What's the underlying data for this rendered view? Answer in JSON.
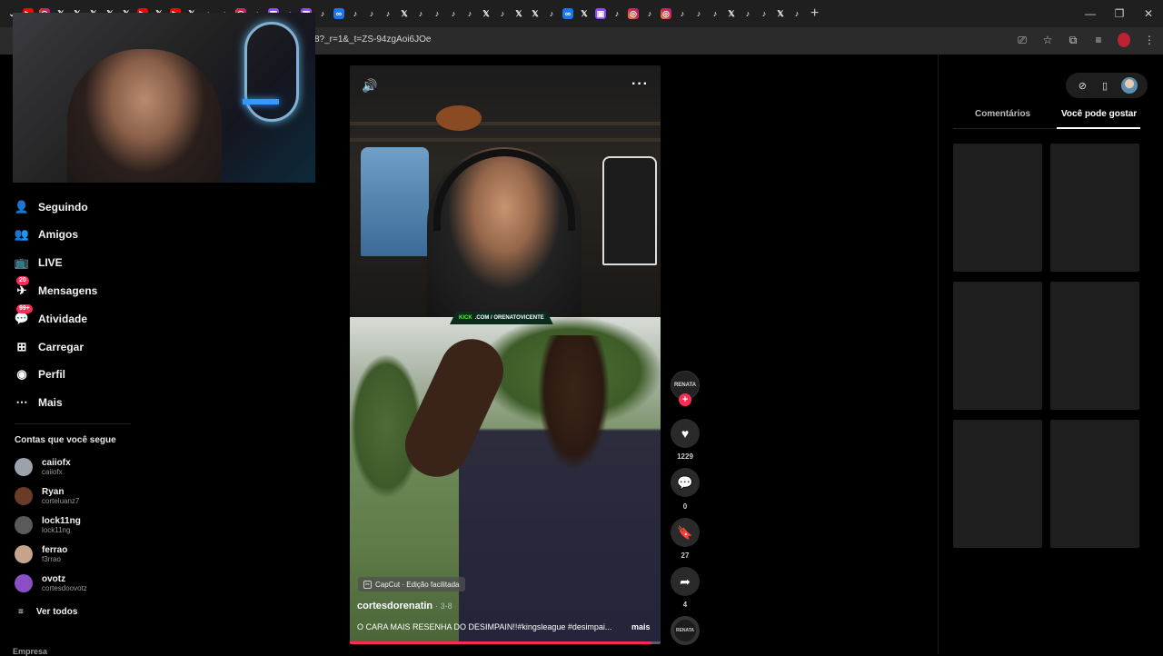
{
  "browser": {
    "tabs": [
      "chevron-down",
      "yt",
      "ig",
      "x",
      "x",
      "x",
      "x",
      "x",
      "yt",
      "x",
      "yt",
      "x",
      "tiktok",
      "tiktok",
      "ig",
      "tiktok",
      "tw",
      "tiktok",
      "tw",
      "tiktok",
      "fb",
      "tiktok",
      "tiktok",
      "tiktok",
      "x",
      "tiktok",
      "tiktok",
      "tiktok",
      "tiktok",
      "x",
      "tiktok",
      "x",
      "x",
      "tiktok",
      "fb",
      "x",
      "tw",
      "tiktok",
      "ig",
      "tiktok",
      "ig",
      "tiktok",
      "tiktok",
      "tiktok",
      "x",
      "tiktok",
      "tiktok",
      "x",
      "tiktok"
    ],
    "tab_glyphs": {
      "tiktok": "♪",
      "x": "𝕏",
      "ig": "◎",
      "tw": "▣",
      "fb": "∞",
      "yt": "▶",
      "chevron-down": "⌄"
    },
    "new_tab": "+",
    "window_controls": {
      "minimize": "—",
      "restore": "❐",
      "close": "✕"
    },
    "url": "8?_r=1&_t=ZS-94zgAoi6JOe",
    "addr_icons": {
      "cast": "⎚",
      "star": "☆",
      "extensions": "⧉",
      "playlist": "≡",
      "menu": "⋮"
    }
  },
  "sidebar": {
    "nav": [
      {
        "icon": "person-plus-icon",
        "glyph": "👤",
        "label": "Seguindo",
        "badge": ""
      },
      {
        "icon": "friends-icon",
        "glyph": "👥",
        "label": "Amigos",
        "badge": ""
      },
      {
        "icon": "live-icon",
        "glyph": "📺",
        "label": "LIVE",
        "badge": ""
      },
      {
        "icon": "messages-icon",
        "glyph": "✈",
        "label": "Mensagens",
        "badge": "20"
      },
      {
        "icon": "activity-icon",
        "glyph": "💬",
        "label": "Atividade",
        "badge": "99+"
      },
      {
        "icon": "upload-icon",
        "glyph": "⊞",
        "label": "Carregar",
        "badge": ""
      },
      {
        "icon": "profile-icon",
        "glyph": "◉",
        "label": "Perfil",
        "badge": ""
      },
      {
        "icon": "more-icon",
        "glyph": "⋯",
        "label": "Mais",
        "badge": ""
      }
    ],
    "following_title": "Contas que você segue",
    "accounts": [
      {
        "name": "caiiofx",
        "user": "caiiofx",
        "color": "#9aa3aa"
      },
      {
        "name": "Ryan",
        "user": "corteluanz7",
        "color": "#6b3b2a"
      },
      {
        "name": "lock11ng",
        "user": "lock11ng",
        "color": "#5a5a5a"
      },
      {
        "name": "ferrao",
        "user": "f3rrao",
        "color": "#c4a48c"
      },
      {
        "name": "ovotz",
        "user": "cortesdoovotz",
        "color": "#8a4fc4"
      }
    ],
    "see_all_glyph": "≡",
    "see_all": "Ver todos",
    "footer_cut": "Empresa"
  },
  "video": {
    "kick_brand": "KICK",
    "kick_url": ".COM / ORENATOVICENTE",
    "mute_glyph": "🔊",
    "more_glyph": "···",
    "capcut_label": "CapCut · Edição facilitada",
    "author": "cortesdorenatin",
    "date": "· 3-8",
    "caption": "O CARA MAIS RESENHA DO DESIMPAIN!!#kingsleague #desimpai...",
    "more": "mais",
    "progress": 0.97
  },
  "actions": {
    "creator_label": "RENATA",
    "follow_glyph": "+",
    "like_glyph": "♥",
    "likes": "1229",
    "comment_glyph": "💬",
    "comments": "0",
    "save_glyph": "🔖",
    "saves": "27",
    "share_glyph": "➦",
    "shares": "4",
    "music_label": "RENATA"
  },
  "right_panel": {
    "tools": {
      "explore_glyph": "⊘",
      "phone_glyph": "▯"
    },
    "tab_comments": "Comentários",
    "tab_suggested": "Você pode gostar",
    "thumb_count": 6
  }
}
